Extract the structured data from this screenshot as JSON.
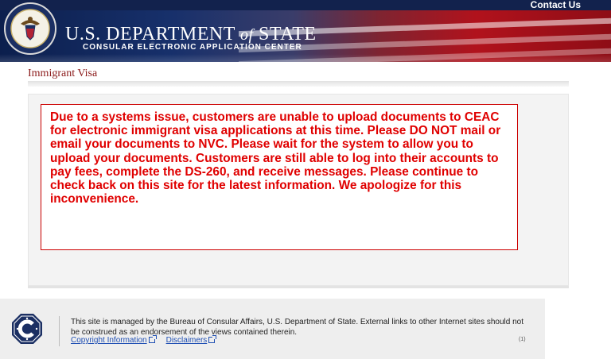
{
  "header": {
    "contact_link": "Contact Us",
    "dept_title_prefix": "U.S. DEPARTMENT",
    "dept_title_of": "of",
    "dept_title_suffix": "STATE",
    "subtitle": "CONSULAR ELECTRONIC APPLICATION CENTER",
    "seal_icon": "department-of-state-seal-icon"
  },
  "page": {
    "title": "Immigrant Visa"
  },
  "notice": {
    "text": "Due to a systems issue, customers are unable to upload documents to CEAC for electronic immigrant visa applications at this time. Please DO NOT mail or email your documents to NVC. Please wait for the system to allow you to upload your documents. Customers are still able to log into their accounts to pay fees, complete the DS-260, and receive messages. Please continue to check back on this site for the latest information. We apologize for this inconvenience.",
    "color": "#e00000",
    "border_color": "#cc0000"
  },
  "footer": {
    "logo_icon": "consular-affairs-logo-icon",
    "statement": "This site is managed by the Bureau of Consular Affairs, U.S. Department of State. External links to other Internet sites should not be construed as an endorsement of the views contained therein.",
    "copyright_link": "Copyright Information",
    "disclaimers_link": "Disclaimers",
    "page_marker": "(1)"
  },
  "colors": {
    "title_red": "#8b1a1a",
    "link_blue": "#1f4fb3",
    "header_navy": "#12224d"
  }
}
